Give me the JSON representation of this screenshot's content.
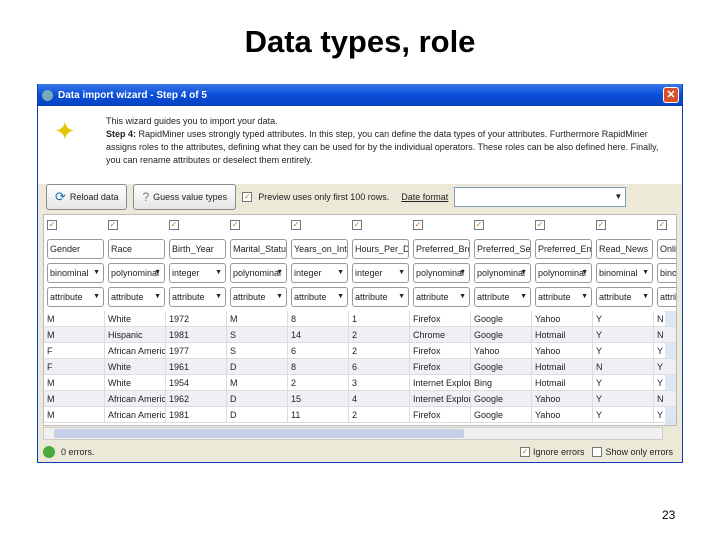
{
  "slide": {
    "title": "Data types, role",
    "page_number": "23"
  },
  "window": {
    "title": "Data import wizard - Step 4 of 5",
    "close": "✕"
  },
  "intro": {
    "line1": "This wizard guides you to import your data.",
    "step_label": "Step 4:",
    "step_text": "RapidMiner uses strongly typed attributes. In this step, you can define the data types of your attributes. Furthermore RapidMiner assigns roles to the attributes, defining what they can be used for by the individual operators. These roles can be also defined here. Finally, you can rename attributes or deselect them entirely."
  },
  "toolbar": {
    "reload": "Reload data",
    "guess": "Guess value types",
    "preview": "Preview uses only first 100 rows.",
    "date_format_label": "Date format",
    "date_format_value": ""
  },
  "columns": [
    {
      "name": "Gender",
      "type": "binominal",
      "role": "attribute"
    },
    {
      "name": "Race",
      "type": "polynominal",
      "role": "attribute"
    },
    {
      "name": "Birth_Year",
      "type": "integer",
      "role": "attribute"
    },
    {
      "name": "Marital_Status",
      "type": "polynominal",
      "role": "attribute"
    },
    {
      "name": "Years_on_Internet",
      "type": "integer",
      "role": "attribute"
    },
    {
      "name": "Hours_Per_Day",
      "type": "integer",
      "role": "attribute"
    },
    {
      "name": "Preferred_Browser",
      "type": "polynominal",
      "role": "attribute"
    },
    {
      "name": "Preferred_Search_Engine",
      "type": "polynominal",
      "role": "attribute"
    },
    {
      "name": "Preferred_Email",
      "type": "polynominal",
      "role": "attribute"
    },
    {
      "name": "Read_News",
      "type": "binominal",
      "role": "attribute"
    },
    {
      "name": "Online_Shopping",
      "type": "binominal",
      "role": "attribute"
    }
  ],
  "rows": [
    [
      "M",
      "White",
      "1972",
      "M",
      "8",
      "1",
      "Firefox",
      "Google",
      "Yahoo",
      "Y",
      "N"
    ],
    [
      "M",
      "Hispanic",
      "1981",
      "S",
      "14",
      "2",
      "Chrome",
      "Google",
      "Hotmail",
      "Y",
      "N"
    ],
    [
      "F",
      "African American",
      "1977",
      "S",
      "6",
      "2",
      "Firefox",
      "Yahoo",
      "Yahoo",
      "Y",
      "Y"
    ],
    [
      "F",
      "White",
      "1961",
      "D",
      "8",
      "6",
      "Firefox",
      "Google",
      "Hotmail",
      "N",
      "Y"
    ],
    [
      "M",
      "White",
      "1954",
      "M",
      "2",
      "3",
      "Internet Explorer",
      "Bing",
      "Hotmail",
      "Y",
      "Y"
    ],
    [
      "M",
      "African American",
      "1962",
      "D",
      "15",
      "4",
      "Internet Explorer",
      "Google",
      "Yahoo",
      "Y",
      "N"
    ],
    [
      "M",
      "African American",
      "1981",
      "D",
      "11",
      "2",
      "Firefox",
      "Google",
      "Yahoo",
      "Y",
      "Y"
    ]
  ],
  "status": {
    "errors": "0 errors.",
    "ignore": "Ignore errors",
    "show_only": "Show only errors"
  }
}
